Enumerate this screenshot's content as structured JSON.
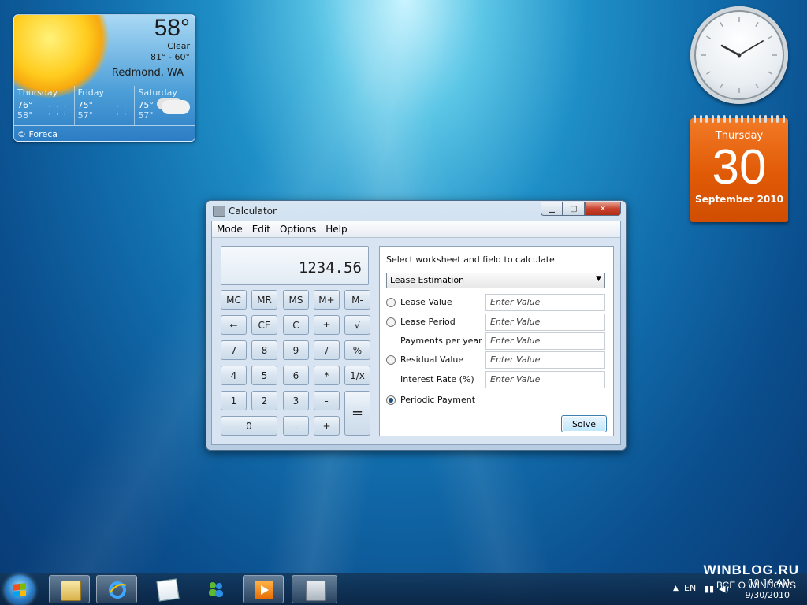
{
  "weather": {
    "temperature": "58°",
    "condition": "Clear",
    "range": "81° - 60°",
    "location": "Redmond, WA",
    "forecast": [
      {
        "day": "Thursday",
        "high": "76°",
        "low": "58°",
        "icon": "sun-icon"
      },
      {
        "day": "Friday",
        "high": "75°",
        "low": "57°",
        "icon": "sun-icon"
      },
      {
        "day": "Saturday",
        "high": "75°",
        "low": "57°",
        "icon": "cloud-icon"
      }
    ],
    "credit": "© Foreca"
  },
  "calendar": {
    "weekday": "Thursday",
    "day": "30",
    "month": "September 2010"
  },
  "calculator": {
    "title": "Calculator",
    "menu": [
      "Mode",
      "Edit",
      "Options",
      "Help"
    ],
    "display": "1234.56",
    "memory_keys": [
      "MC",
      "MR",
      "MS",
      "M+",
      "M-"
    ],
    "row2_keys": [
      "←",
      "CE",
      "C",
      "±",
      "√"
    ],
    "row3_keys": [
      "7",
      "8",
      "9",
      "/",
      "%"
    ],
    "row4_keys": [
      "4",
      "5",
      "6",
      "*",
      "1/x"
    ],
    "row5_keys": [
      "1",
      "2",
      "3",
      "-"
    ],
    "row6_keys": [
      "0",
      ".",
      "+"
    ],
    "equals_key": "=",
    "worksheet_header": "Select worksheet and field to calculate",
    "worksheet_selected": "Lease Estimation",
    "fields": [
      {
        "label": "Lease Value",
        "placeholder": "Enter Value",
        "radio": true,
        "selected": false
      },
      {
        "label": "Lease Period",
        "placeholder": "Enter Value",
        "radio": true,
        "selected": false
      },
      {
        "label": "Payments per year",
        "placeholder": "Enter Value",
        "radio": false,
        "selected": false
      },
      {
        "label": "Residual Value",
        "placeholder": "Enter Value",
        "radio": true,
        "selected": false
      },
      {
        "label": "Interest Rate (%)",
        "placeholder": "Enter Value",
        "radio": false,
        "selected": false
      }
    ],
    "result_label": "Periodic Payment",
    "solve_label": "Solve"
  },
  "taskbar": {
    "time": "10:10 AM",
    "date": "9/30/2010",
    "lang": "EN"
  },
  "watermark": {
    "site": "WINBLOG.RU",
    "tagline": "ВСЁ О WINDOWS"
  }
}
